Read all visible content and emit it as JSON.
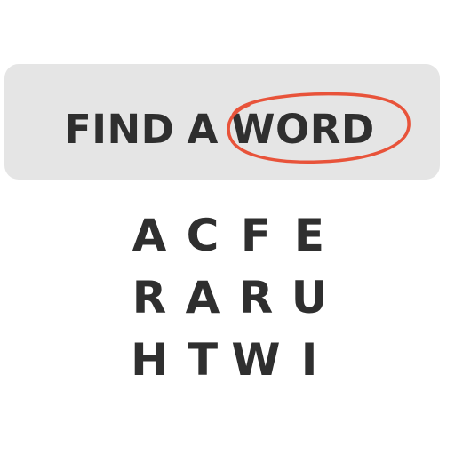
{
  "banner": {
    "word1": "FIND",
    "word2": "A",
    "word3": "WORD",
    "circle_color": "#e8533a"
  },
  "grid": {
    "rows": [
      [
        "A",
        "C",
        "F",
        "E"
      ],
      [
        "R",
        "A",
        "R",
        "U"
      ],
      [
        "H",
        "T",
        "W",
        "I"
      ]
    ]
  }
}
